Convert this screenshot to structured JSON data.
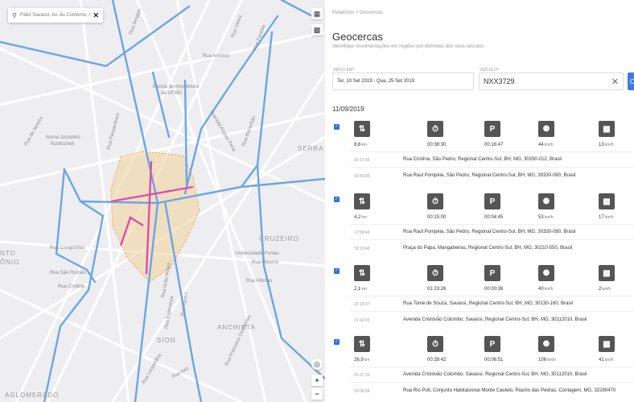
{
  "map": {
    "search_text": "Pátio Savassi, Av. do Contorno, /",
    "labels": [
      "Rua Sergipe",
      "Rua Ceará",
      "Rua Paraíba",
      "Rua Amorós",
      "Escola de Arquitetura",
      "da UFMG",
      "Rua de Janeiro",
      "Arena Juscelino",
      "Kubitschek",
      "Rua Pernambuco",
      "Avenida Afonso Pena",
      "Rua Maranhão",
      "SERRA",
      "CRUZEIRO",
      "Universidade Fumec",
      "Rua Oliveira",
      "Rua Alfenas",
      "ANCHIETA",
      "SION",
      "Rua Francisco Deslandes",
      "Rua Congonhas",
      "Rua São Romão",
      "Rua Cristina",
      "Rua Grão Mogol",
      "Rua Esperança",
      "AGLOMERADO",
      "Rua Itaú",
      "Rua Leopoldina",
      "Rua Pium-í",
      "NTO",
      "ÔNIO"
    ]
  },
  "panel": {
    "breadcrumb": "Relatórios > Geocercas",
    "title": "Geocercas",
    "subtitle": "Identifique movimentações em regiões pré-definidas dos seus veículos",
    "period_label": "INÍCIO EM*",
    "period_value": "Ter, 10 Set 2019 - Qua, 25 Set 2019",
    "vehicle_label": "VEÍCULO*",
    "vehicle_value": "NXX3729",
    "date_header": "11/09/2019"
  },
  "trips": [
    {
      "distance": "8,6",
      "distance_unit": "km",
      "duration": "00:38:30",
      "stopped": "00:16:47",
      "max_speed": "44",
      "avg_speed": "13",
      "speed_unit": "km/h",
      "start_time": "16:17:35",
      "start_addr": "Rua Cristina, São Pedro, Regional Centro-Sul, BH, MG, 30330-012, Brasil",
      "end_time": "16:56:05",
      "end_addr": "Rua Raul Pompéia, São Pedro, Regional Centro-Sul, BH, MG, 30330-080, Brasil"
    },
    {
      "distance": "4,2",
      "distance_unit": "km",
      "duration": "00:15:00",
      "stopped": "00:04:45",
      "max_speed": "53",
      "avg_speed": "17",
      "speed_unit": "km/h",
      "start_time": "17:58:40",
      "start_addr": "Rua Raul Pompéia, São Pedro, Regional Centro-Sul, BH, MG, 30330-080, Brasil",
      "end_time": "18:13:40",
      "end_addr": "Praça do Papa, Mangabeiras, Regional Centro-Sul, BH, MG, 30210-550, Brasil"
    },
    {
      "distance": "2,1",
      "distance_unit": "km",
      "duration": "01:23:26",
      "stopped": "00:00:36",
      "max_speed": "40",
      "avg_speed": "2",
      "speed_unit": "km/h",
      "start_time": "20:18:37",
      "start_addr": "Rua Tomé de Souza, Savassi, Regional Centro-Sul, BH, MG, 30130-160, Brasil",
      "end_time": "21:42:03",
      "end_addr": "Avenida Cristóvão Colombo, Savassi, Regional Centro-Sul, BH, MG, 30112010, Brasil"
    },
    {
      "distance": "26,9",
      "distance_unit": "km",
      "duration": "00:39:42",
      "stopped": "00:06:51",
      "max_speed": "106",
      "avg_speed": "41",
      "speed_unit": "km/h",
      "start_time": "22:27:16",
      "start_addr": "Avenida Cristóvão Colombo, Savassi, Regional Centro-Sul, BH, MG, 30112010, Brasil",
      "end_time": "23:06:58",
      "end_addr": "Rua Rio Poti, Conjunto Habitacional Monte Castelo, Riacho das Pedras, Contagem, MG, 32280470"
    }
  ],
  "icons": {
    "distance": "route-icon",
    "duration": "stopwatch-icon",
    "stopped": "parking-icon",
    "max_speed": "speedometer-icon",
    "avg_speed": "bus-icon"
  },
  "colors": {
    "accent": "#2e73d8",
    "route": "#6aa6e8",
    "geofence": "#f2d3a0",
    "path": "#e04ca8"
  }
}
